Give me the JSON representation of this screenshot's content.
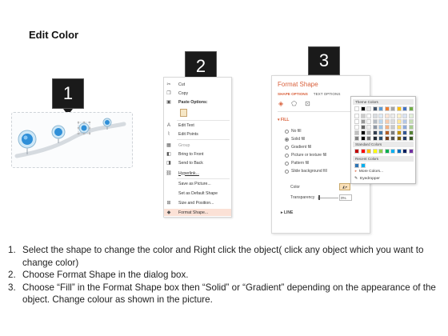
{
  "title": "Edit Color",
  "steps": [
    "1",
    "2",
    "3"
  ],
  "context_menu": {
    "items": [
      {
        "label": "Cut",
        "icon": "scissors-icon"
      },
      {
        "label": "Copy",
        "icon": "copy-icon"
      },
      {
        "label": "Paste Options:",
        "icon": "paste-icon"
      },
      {
        "label": "",
        "icon": "paste-option-icon"
      },
      {
        "label": "Edit Text",
        "icon": "edit-text-icon"
      },
      {
        "label": "Edit Points",
        "icon": "edit-points-icon"
      },
      {
        "label": "Group",
        "icon": "group-icon"
      },
      {
        "label": "Bring to Front",
        "icon": "bring-front-icon"
      },
      {
        "label": "Send to Back",
        "icon": "send-back-icon"
      },
      {
        "label": "Hyperlink...",
        "icon": "hyperlink-icon"
      },
      {
        "label": "Save as Picture...",
        "icon": ""
      },
      {
        "label": "Set as Default Shape",
        "icon": ""
      },
      {
        "label": "Size and Position...",
        "icon": "size-position-icon"
      },
      {
        "label": "Format Shape...",
        "icon": "format-shape-icon"
      }
    ]
  },
  "format_shape": {
    "title": "Format Shape",
    "tabs": [
      "SHAPE OPTIONS",
      "TEXT OPTIONS"
    ],
    "fill_heading": "FILL",
    "fill_options": [
      {
        "label": "No fill",
        "selected": false
      },
      {
        "label": "Solid fill",
        "selected": true
      },
      {
        "label": "Gradient fill",
        "selected": false
      },
      {
        "label": "Picture or texture fill",
        "selected": false
      },
      {
        "label": "Pattern fill",
        "selected": false
      },
      {
        "label": "Slide background fill",
        "selected": false
      }
    ],
    "color_label": "Color",
    "transparency_label": "Transparency",
    "transparency_value": "0%",
    "line_heading": "LINE"
  },
  "color_flyout": {
    "theme_colors_label": "Theme Colors",
    "standard_colors_label": "Standard Colors",
    "recent_colors_label": "Recent Colors",
    "more_colors_label": "More Colors...",
    "eyedropper_label": "Eyedropper",
    "theme_top_row": [
      "#ffffff",
      "#000000",
      "#e7e6e6",
      "#44546a",
      "#5b9bd5",
      "#ed7d31",
      "#a5a5a5",
      "#ffc000",
      "#4472c4",
      "#70ad47"
    ],
    "standard_colors": [
      "#c00000",
      "#ff0000",
      "#ffc000",
      "#ffff00",
      "#92d050",
      "#00b050",
      "#00b0f0",
      "#0070c0",
      "#002060",
      "#7030a0"
    ],
    "recent_colors": [
      "#2e75b6",
      "#00b0f0"
    ]
  },
  "instructions": [
    {
      "num": "1.",
      "text": "Select the shape to change the color and Right click the object( click any object which you want to change color)"
    },
    {
      "num": "2.",
      "text": "Choose Format Shape in the dialog box."
    },
    {
      "num": "3.",
      "text": "Choose “Fill” in the Format Shape box then “Solid” or “Gradient” depending on the appearance of the object. Change colour as shown in the picture."
    }
  ]
}
